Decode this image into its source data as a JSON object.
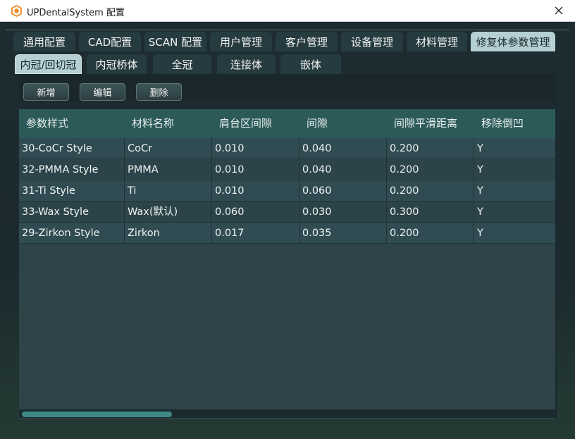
{
  "window": {
    "title": "UPDentalSystem 配置",
    "icon": "app-logo-icon",
    "close_icon": "close-icon"
  },
  "tabs": [
    {
      "label": "通用配置",
      "active": false
    },
    {
      "label": "CAD配置",
      "active": false
    },
    {
      "label": "SCAN 配置",
      "active": false
    },
    {
      "label": "用户管理",
      "active": false
    },
    {
      "label": "客户管理",
      "active": false
    },
    {
      "label": "设备管理",
      "active": false
    },
    {
      "label": "材料管理",
      "active": false
    },
    {
      "label": "修复体参数管理",
      "active": true
    }
  ],
  "subtabs": [
    {
      "label": "内冠/回切冠",
      "active": true
    },
    {
      "label": "内冠桥体",
      "active": false
    },
    {
      "label": "全冠",
      "active": false
    },
    {
      "label": "连接体",
      "active": false
    },
    {
      "label": "嵌体",
      "active": false
    }
  ],
  "toolbar": {
    "add_label": "新增",
    "edit_label": "编辑",
    "delete_label": "删除"
  },
  "table": {
    "columns": [
      "参数样式",
      "材料名称",
      "肩台区间隙",
      "间隙",
      "间隙平滑距离",
      "移除倒凹"
    ],
    "rows": [
      [
        "30-CoCr Style",
        "CoCr",
        "0.010",
        "0.040",
        "0.200",
        "Y"
      ],
      [
        "32-PMMA Style",
        "PMMA",
        "0.010",
        "0.040",
        "0.200",
        "Y"
      ],
      [
        "31-Ti Style",
        "Ti",
        "0.010",
        "0.060",
        "0.200",
        "Y"
      ],
      [
        "33-Wax Style",
        "Wax(默认)",
        "0.060",
        "0.030",
        "0.300",
        "Y"
      ],
      [
        "29-Zirkon Style",
        "Zirkon",
        "0.017",
        "0.035",
        "0.200",
        "Y"
      ]
    ]
  },
  "colors": {
    "accent": "#2b5a59",
    "active_tab": "#b5d0d2",
    "scroll_thumb": "#3f8a86"
  }
}
